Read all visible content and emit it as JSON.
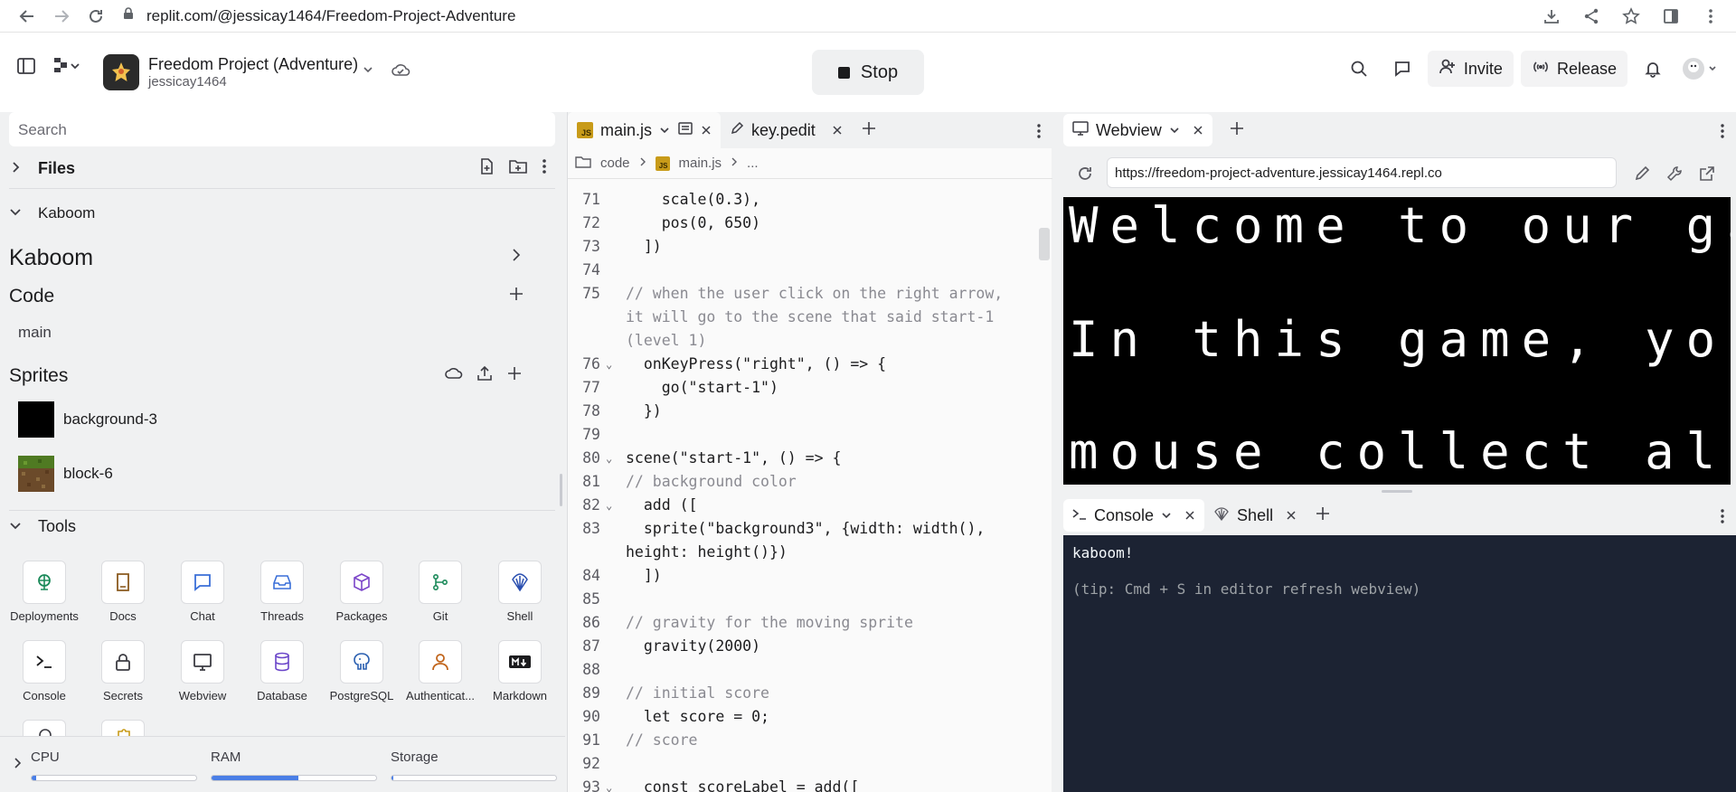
{
  "browser": {
    "url": "replit.com/@jessicay1464/Freedom-Project-Adventure"
  },
  "header": {
    "repl_name": "Freedom Project (Adventure)",
    "username": "jessicay1464",
    "stop_label": "Stop",
    "invite_label": "Invite",
    "release_label": "Release"
  },
  "sidebar": {
    "search_placeholder": "Search",
    "files_label": "Files",
    "kaboom_section": "Kaboom",
    "kaboom_title": "Kaboom",
    "code_heading": "Code",
    "code_items": [
      "main"
    ],
    "sprites_heading": "Sprites",
    "sprites": [
      {
        "name": "background-3",
        "thumb_color": "#000000"
      },
      {
        "name": "block-6",
        "thumb_color": "#5a7a2c"
      }
    ],
    "tools_heading": "Tools",
    "tools": [
      {
        "label": "Deployments",
        "icon": "deployments-icon"
      },
      {
        "label": "Docs",
        "icon": "docs-icon"
      },
      {
        "label": "Chat",
        "icon": "chat-icon"
      },
      {
        "label": "Threads",
        "icon": "threads-icon"
      },
      {
        "label": "Packages",
        "icon": "packages-icon"
      },
      {
        "label": "Git",
        "icon": "git-icon"
      },
      {
        "label": "Shell",
        "icon": "shell-icon"
      },
      {
        "label": "Console",
        "icon": "console-icon"
      },
      {
        "label": "Secrets",
        "icon": "secrets-icon"
      },
      {
        "label": "Webview",
        "icon": "webview-icon"
      },
      {
        "label": "Database",
        "icon": "database-icon"
      },
      {
        "label": "PostgreSQL",
        "icon": "postgresql-icon"
      },
      {
        "label": "Authenticat...",
        "icon": "authentication-icon"
      },
      {
        "label": "Markdown",
        "icon": "markdown-icon"
      }
    ],
    "resources": {
      "cpu_label": "CPU",
      "ram_label": "RAM",
      "storage_label": "Storage",
      "cpu_fraction": 0.03,
      "ram_fraction": 0.53,
      "storage_fraction": 0.01
    }
  },
  "editor": {
    "tabs": [
      {
        "label": "main.js",
        "active": true
      },
      {
        "label": "key.pedit",
        "active": false
      }
    ],
    "breadcrumb": [
      "code",
      "main.js",
      "..."
    ],
    "lines": [
      {
        "n": "71",
        "fold": false,
        "text": "    scale(0.3),"
      },
      {
        "n": "72",
        "fold": false,
        "text": "    pos(0, 650)"
      },
      {
        "n": "73",
        "fold": false,
        "text": "  ])"
      },
      {
        "n": "74",
        "fold": false,
        "text": ""
      },
      {
        "n": "75",
        "fold": false,
        "text": "// when the user click on the right arrow,"
      },
      {
        "n": "",
        "fold": false,
        "text": "it will go to the scene that said start-1"
      },
      {
        "n": "",
        "fold": false,
        "text": "(level 1)"
      },
      {
        "n": "76",
        "fold": true,
        "text": "  onKeyPress(\"right\", () => {"
      },
      {
        "n": "77",
        "fold": false,
        "text": "    go(\"start-1\")"
      },
      {
        "n": "78",
        "fold": false,
        "text": "  })"
      },
      {
        "n": "79",
        "fold": false,
        "text": ""
      },
      {
        "n": "80",
        "fold": true,
        "text": "scene(\"start-1\", () => {"
      },
      {
        "n": "81",
        "fold": false,
        "text": "// background color"
      },
      {
        "n": "82",
        "fold": true,
        "text": "  add (["
      },
      {
        "n": "83",
        "fold": false,
        "text": "  sprite(\"background3\", {width: width(),"
      },
      {
        "n": "",
        "fold": false,
        "text": "height: height()})"
      },
      {
        "n": "84",
        "fold": false,
        "text": "  ])"
      },
      {
        "n": "85",
        "fold": false,
        "text": ""
      },
      {
        "n": "86",
        "fold": false,
        "text": "// gravity for the moving sprite"
      },
      {
        "n": "87",
        "fold": false,
        "text": "  gravity(2000)"
      },
      {
        "n": "88",
        "fold": false,
        "text": ""
      },
      {
        "n": "89",
        "fold": false,
        "text": "// initial score"
      },
      {
        "n": "90",
        "fold": false,
        "text": "  let score = 0;"
      },
      {
        "n": "91",
        "fold": false,
        "text": "// score"
      },
      {
        "n": "92",
        "fold": false,
        "text": ""
      },
      {
        "n": "93",
        "fold": true,
        "text": "  const scoreLabel = add(["
      }
    ]
  },
  "webview": {
    "tab_label": "Webview",
    "url": "https://freedom-project-adventure.jessicay1464.repl.co",
    "screen_lines": [
      "Welcome to our ga",
      "In this game, you",
      "mouse collect al"
    ]
  },
  "console": {
    "tabs": [
      {
        "label": "Console",
        "active": true
      },
      {
        "label": "Shell",
        "active": false
      }
    ],
    "output": "kaboom!",
    "tip": "(tip: Cmd + S in editor refresh webview)"
  },
  "colors": {
    "accent": "#4a7ee6",
    "console_bg": "#1c2333",
    "js_badge": "#c89b19"
  }
}
